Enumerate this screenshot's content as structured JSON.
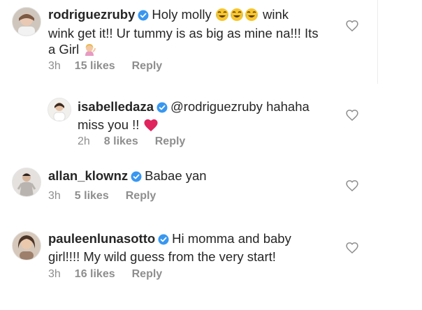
{
  "comments": [
    {
      "username": "rodriguezruby",
      "text_line1_a": "Holy molly",
      "text_line1_b": "wink",
      "text_line2": "wink get it!! Ur tummy is as big as mine na!!! Its",
      "text_line3": "a Girl",
      "time": "3h",
      "likes": "15 likes",
      "reply": "Reply"
    },
    {
      "username": "isabelledaza",
      "mention": "@rodriguezruby",
      "text_line1": "hahaha",
      "text_line2": "miss you !!",
      "time": "2h",
      "likes": "8 likes",
      "reply": "Reply"
    },
    {
      "username": "allan_klownz",
      "text_line1": "Babae yan",
      "time": "3h",
      "likes": "5 likes",
      "reply": "Reply"
    },
    {
      "username": "pauleenlunasotto",
      "text_line1": "Hi momma and baby",
      "text_line2": "girl!!!! My wild guess from the very start!",
      "time": "3h",
      "likes": "16 likes",
      "reply": "Reply"
    }
  ],
  "icons": {
    "like": "heart-outline-icon",
    "verified": "verified-badge-icon",
    "laughing": "tears-of-joy-emoji",
    "person": "person-tipping-hand-emoji",
    "heart": "red-heart-emoji"
  },
  "colors": {
    "text": "#262626",
    "secondary": "#8e8e8e",
    "verified": "#3897f0",
    "heart": "#e0245e"
  }
}
